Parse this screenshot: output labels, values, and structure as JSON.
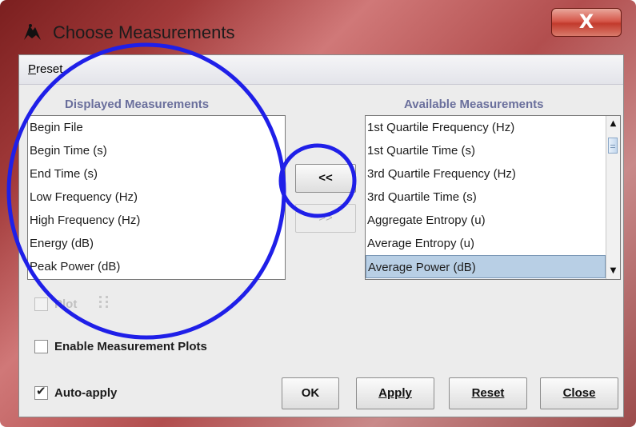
{
  "window": {
    "title": "Choose Measurements",
    "close_label": "X"
  },
  "menu": {
    "preset_prefix": "P",
    "preset_rest": "reset"
  },
  "displayed": {
    "title": "Displayed Measurements",
    "items": [
      "Begin File",
      "Begin Time (s)",
      "End Time (s)",
      "Low Frequency (Hz)",
      "High Frequency (Hz)",
      "Energy (dB)",
      "Peak Power (dB)"
    ]
  },
  "available": {
    "title": "Available Measurements",
    "items": [
      "1st Quartile Frequency (Hz)",
      "1st Quartile Time (s)",
      "3rd Quartile Frequency (Hz)",
      "3rd Quartile Time (s)",
      "Aggregate Entropy (u)",
      "Average Entropy (u)",
      "Average Power (dB)"
    ],
    "selected_index": 6
  },
  "transfer": {
    "add_label": "<<",
    "remove_label": ">>"
  },
  "options": {
    "plot_label": "Plot",
    "plot_checked": false,
    "enable_plots_label": "Enable Measurement Plots",
    "enable_plots_checked": false,
    "auto_apply_label": "Auto-apply",
    "auto_apply_checked": true
  },
  "buttons": {
    "ok": "OK",
    "apply": "Apply",
    "reset": "Reset",
    "close": "Close"
  },
  "colors": {
    "annotation_blue": "#1f1fe8",
    "selection": "#b8cfe5",
    "section_title": "#6a6f9c"
  },
  "icons": {
    "title_icon": "bat-icon",
    "close_icon": "close-icon",
    "up_icon": "arrow-up-icon",
    "down_icon": "arrow-down-icon",
    "check_icon": "checkmark-icon"
  }
}
